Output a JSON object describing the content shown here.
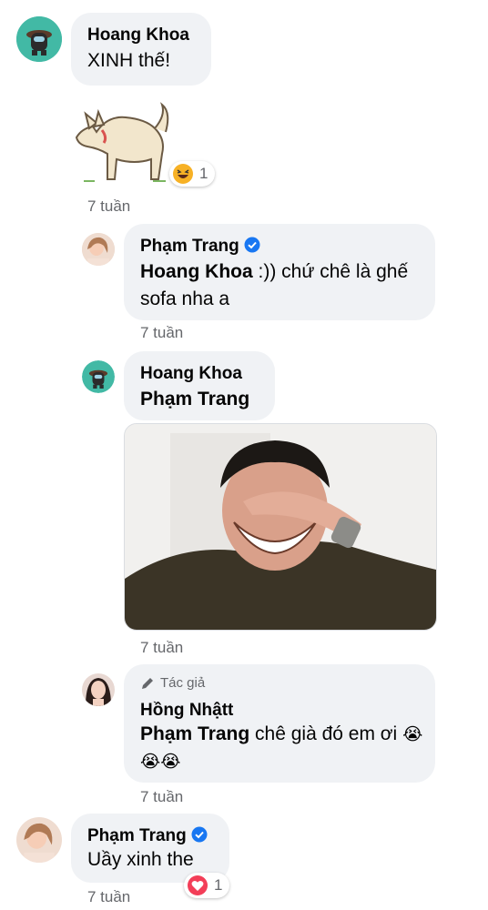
{
  "comments": [
    {
      "author": "Hoang Khoa",
      "text": "XINH thế!",
      "reaction": {
        "icon": "haha-emoji",
        "count": "1"
      },
      "time": "7 tuần"
    },
    {
      "author": "Phạm Trang",
      "mention": "Hoang Khoa",
      "text": " :)) chứ chê là ghế sofa nha a",
      "time": "7 tuần"
    },
    {
      "author": "Hoang Khoa",
      "mention": "Phạm Trang",
      "time": "7 tuần"
    },
    {
      "badge": "Tác giả",
      "author": "Hồng Nhậtt",
      "mention": "Phạm Trang",
      "text": " chê già đó em ơi",
      "emoji": "😭😭😭",
      "time": "7 tuần"
    },
    {
      "author": "Phạm Trang",
      "text": "Uầy xinh the",
      "reaction": {
        "icon": "heart-emoji",
        "count": "1"
      },
      "time": "7 tuần"
    }
  ],
  "colors": {
    "bubble": "#f0f2f5",
    "verified": "#1877f2",
    "muted": "#65676b"
  }
}
